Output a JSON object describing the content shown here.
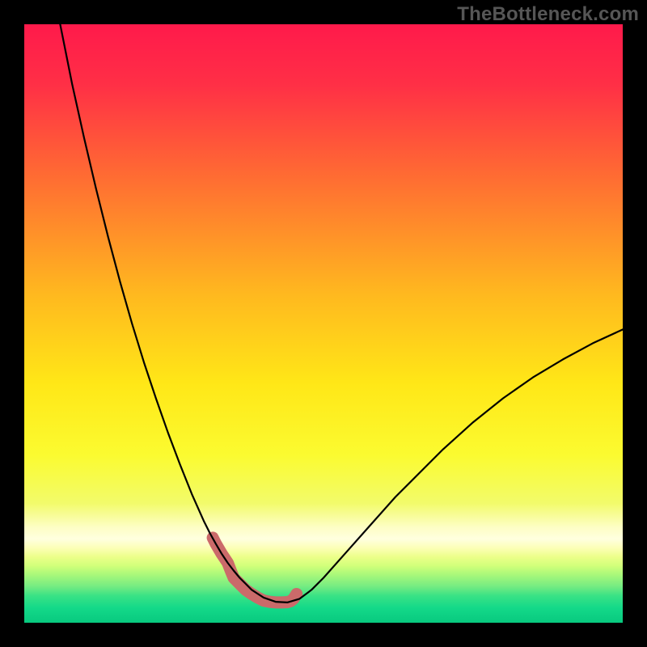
{
  "watermark": "TheBottleneck.com",
  "chart_data": {
    "type": "line",
    "title": "",
    "xlabel": "",
    "ylabel": "",
    "xlim": [
      0,
      100
    ],
    "ylim": [
      0,
      100
    ],
    "series": [
      {
        "name": "bottleneck-curve",
        "x": [
          6,
          8,
          10,
          12,
          14,
          16,
          18,
          20,
          22,
          24,
          26,
          28,
          30,
          31,
          32,
          33,
          34,
          35,
          36,
          37,
          38,
          40,
          42,
          44,
          46,
          48,
          50,
          54,
          58,
          62,
          66,
          70,
          75,
          80,
          85,
          90,
          95,
          100
        ],
        "values": [
          100,
          90,
          81,
          72.5,
          64.5,
          57,
          50,
          43.5,
          37.5,
          31.8,
          26.5,
          21.5,
          17,
          15,
          13.2,
          11.5,
          10,
          8.7,
          7.5,
          6.5,
          5.5,
          4.2,
          3.5,
          3.4,
          4,
          5.5,
          7.5,
          12,
          16.5,
          21,
          25,
          29,
          33.5,
          37.5,
          41,
          44,
          46.7,
          49
        ]
      },
      {
        "name": "highlight-segment",
        "x": [
          31.5,
          32,
          33,
          34,
          34.5,
          35,
          36,
          37,
          38,
          39,
          40,
          41,
          42,
          43,
          44,
          44.5,
          45,
          45.5
        ],
        "values": [
          14.2,
          13.2,
          11.5,
          10,
          8.7,
          7.5,
          6.5,
          5.5,
          4.8,
          4.2,
          3.7,
          3.5,
          3.4,
          3.4,
          3.45,
          3.6,
          4,
          4.8
        ]
      }
    ],
    "highlight_dot": {
      "x": 31.5,
      "y": 14.2
    },
    "gradient_stops": [
      {
        "offset": 0.0,
        "color": "#ff1a4b"
      },
      {
        "offset": 0.1,
        "color": "#ff2f46"
      },
      {
        "offset": 0.25,
        "color": "#ff6a33"
      },
      {
        "offset": 0.45,
        "color": "#ffb81f"
      },
      {
        "offset": 0.6,
        "color": "#ffe717"
      },
      {
        "offset": 0.72,
        "color": "#fbfb30"
      },
      {
        "offset": 0.8,
        "color": "#f2fb6a"
      },
      {
        "offset": 0.84,
        "color": "#fdfec4"
      },
      {
        "offset": 0.86,
        "color": "#ffffdf"
      },
      {
        "offset": 0.875,
        "color": "#fcffb7"
      },
      {
        "offset": 0.89,
        "color": "#ecff8a"
      },
      {
        "offset": 0.905,
        "color": "#d1ff7a"
      },
      {
        "offset": 0.92,
        "color": "#a8f87a"
      },
      {
        "offset": 0.94,
        "color": "#73eb82"
      },
      {
        "offset": 0.955,
        "color": "#39e285"
      },
      {
        "offset": 0.975,
        "color": "#14d989"
      },
      {
        "offset": 1.0,
        "color": "#08c97f"
      }
    ],
    "colors": {
      "curve": "#000000",
      "highlight": "#cb6a6a",
      "dot": "#cb6a6a"
    }
  }
}
